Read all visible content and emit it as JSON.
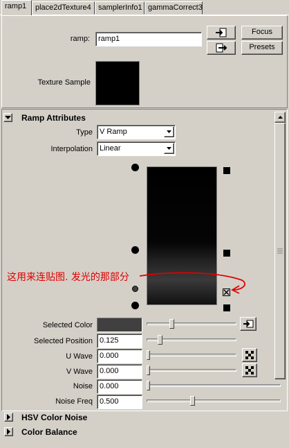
{
  "tabs": [
    {
      "label": "ramp1"
    },
    {
      "label": "place2dTexture4"
    },
    {
      "label": "samplerInfo1"
    },
    {
      "label": "gammaCorrect3"
    }
  ],
  "header": {
    "ramp_label": "ramp:",
    "ramp_value": "ramp1",
    "focus_label": "Focus",
    "presets_label": "Presets",
    "texture_sample_label": "Texture Sample"
  },
  "ramp_attributes": {
    "title": "Ramp Attributes",
    "type_label": "Type",
    "type_value": "V Ramp",
    "interpolation_label": "Interpolation",
    "interpolation_value": "Linear",
    "selected_color_label": "Selected Color",
    "selected_color": "#404040",
    "selected_position_label": "Selected Position",
    "selected_position_value": "0.125",
    "u_wave_label": "U Wave",
    "u_wave_value": "0.000",
    "v_wave_label": "V Wave",
    "v_wave_value": "0.000",
    "noise_label": "Noise",
    "noise_value": "0.000",
    "noise_freq_label": "Noise Freq",
    "noise_freq_value": "0.500"
  },
  "annotation": {
    "text": "这用来连贴图. 发光的那部分",
    "color": "#e00000"
  },
  "sections": {
    "hsv_title": "HSV Color Noise",
    "balance_title": "Color Balance"
  }
}
